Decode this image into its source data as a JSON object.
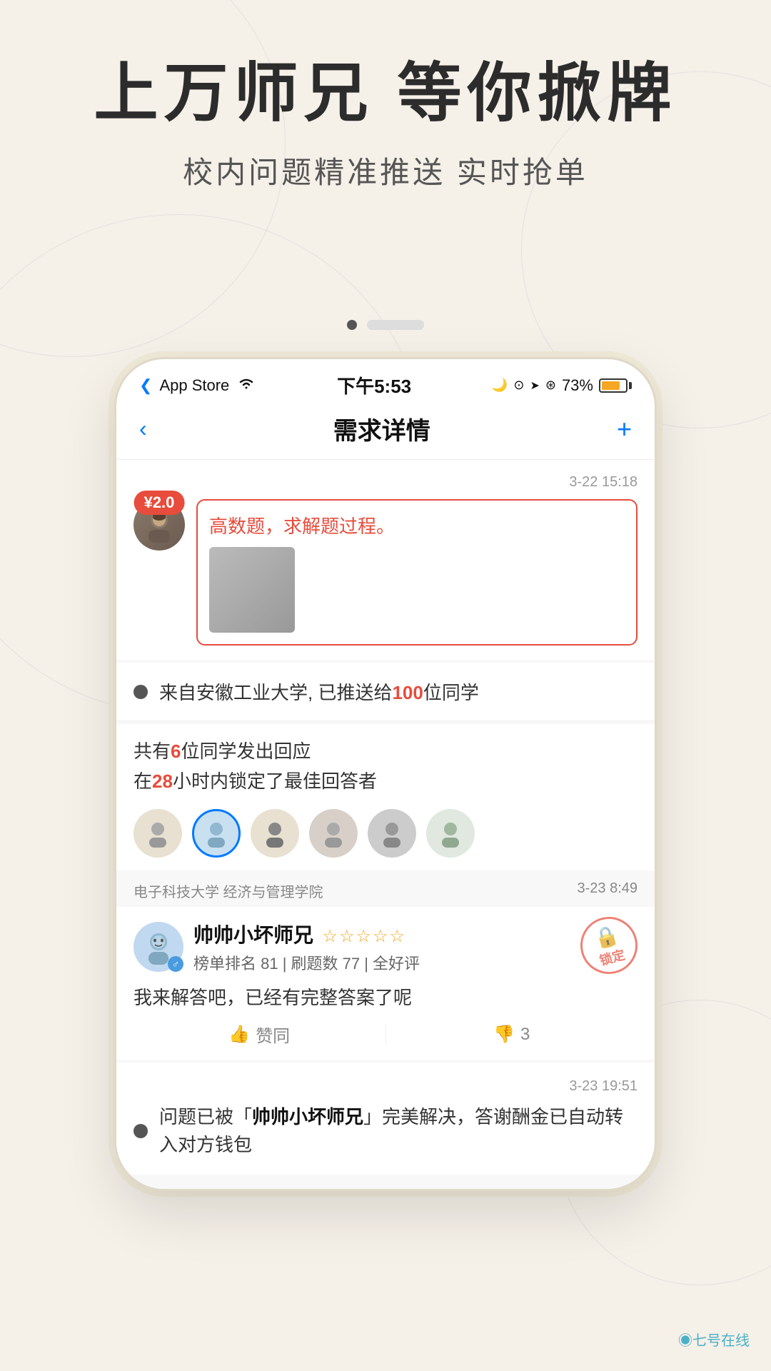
{
  "hero": {
    "title": "上万师兄 等你掀牌",
    "subtitle": "校内问题精准推送  实时抢单"
  },
  "pagination": {
    "active_dot": 0,
    "dots_count": 1,
    "bar": true
  },
  "status_bar": {
    "left": "App Store",
    "wifi": "wifi",
    "time": "下午5:53",
    "moon": "🌙",
    "lock": "🔒",
    "location": "➤",
    "alert": "🔔",
    "battery": "73%"
  },
  "nav": {
    "back_icon": "‹",
    "title": "需求详情",
    "plus_icon": "+"
  },
  "question": {
    "timestamp": "3-22 15:18",
    "price": "¥2.0",
    "text": "高数题，求解题过程。",
    "has_image": true
  },
  "info1": {
    "text_before": "来自安徽工业大学, 已推送给",
    "highlight": "100",
    "text_after": "位同学"
  },
  "info2": {
    "line1_before": "共有",
    "line1_highlight": "6",
    "line1_after": "位同学发出回应",
    "line2_before": "在",
    "line2_highlight": "28",
    "line2_after": "小时内锁定了最佳回答者"
  },
  "university_label": {
    "school": "电子科技大学  经济与管理学院",
    "timestamp": "3-23 8:49"
  },
  "answer": {
    "name": "帅帅小坏师兄",
    "stars": "☆☆☆☆☆",
    "stats": "榜单排名 81 | 刷题数 77 | 全好评",
    "content": "我来解答吧，已经有完整答案了呢",
    "locked_text": "锁定",
    "like_icon": "👍",
    "like_label": "赞同",
    "dislike_icon": "👎",
    "dislike_count": "3"
  },
  "bottom": {
    "timestamp": "3-23 19:51",
    "text_before": "问题已被「",
    "name": "帅帅小坏师兄",
    "text_after": "」完美解决，答谢酬金已自动转入对方钱包"
  },
  "watermark": "◉七号在线"
}
